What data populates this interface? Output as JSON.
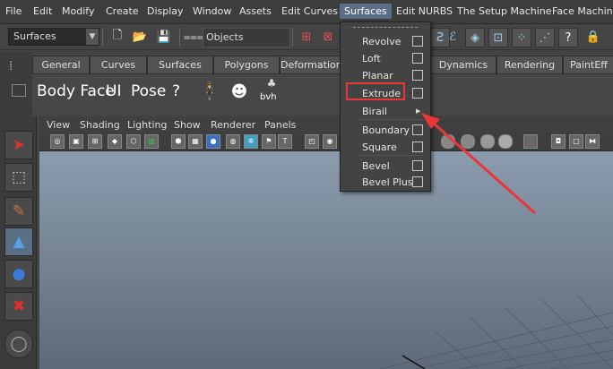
{
  "menubar": [
    "File",
    "Edit",
    "Modify",
    "Create",
    "Display",
    "Window",
    "Assets",
    "Edit Curves",
    "Surfaces",
    "Edit NURBS",
    "The Setup Machine",
    "Face Machine"
  ],
  "status_combo": "Surfaces",
  "objects_field": "Objects",
  "shelf_tabs": [
    "General",
    "Curves",
    "Surfaces",
    "Polygons",
    "Deformation",
    "Dynamics",
    "Rendering",
    "PaintEff"
  ],
  "shelf_buttons": {
    "body_face": "Body Face",
    "ui": "UI",
    "pose": "Pose",
    "help": "?",
    "bvh": "bvh"
  },
  "panel_menu": [
    "View",
    "Shading",
    "Lighting",
    "Show",
    "Renderer",
    "Panels"
  ],
  "surfaces_menu": [
    {
      "label": "Revolve",
      "option": true
    },
    {
      "label": "Loft",
      "option": true
    },
    {
      "label": "Planar",
      "option": true
    },
    {
      "label": "Extrude",
      "option": true
    },
    {
      "label": "Birail",
      "submenu": true
    },
    {
      "label": "Boundary",
      "option": true
    },
    {
      "label": "Square",
      "option": true
    },
    {
      "label": "Bevel",
      "option": true
    },
    {
      "label": "Bevel Plus",
      "option": true
    }
  ],
  "annotation_color": "#e8363b"
}
